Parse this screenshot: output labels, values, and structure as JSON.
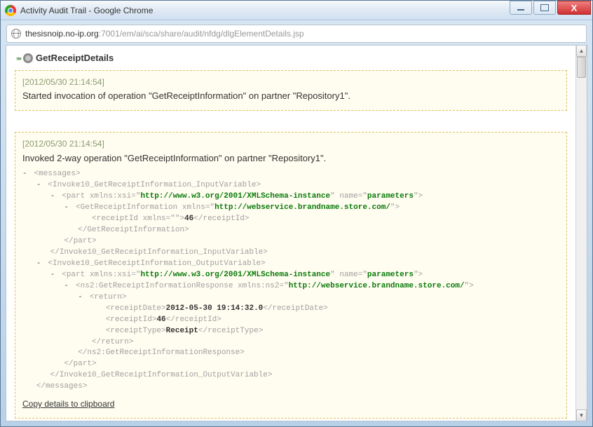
{
  "window": {
    "title": "Activity Audit Trail - Google Chrome"
  },
  "url": {
    "host": "thesisnoip.no-ip.org",
    "path": ":7001/em/ai/sca/share/audit/nfdg/dlgElementDetails.jsp"
  },
  "heading": {
    "text": "GetReceiptDetails"
  },
  "blocks": [
    {
      "timestamp": "[2012/05/30 21:14:54]",
      "message": "Started invocation of operation \"GetReceiptInformation\" on partner \"Repository1\"."
    },
    {
      "timestamp": "[2012/05/30 21:14:54]",
      "message": "Invoked 2-way operation \"GetReceiptInformation\" on partner \"Repository1\".",
      "xml": {
        "root": "messages",
        "input_var": "Invoke10_GetReceiptInformation_InputVariable",
        "output_var": "Invoke10_GetReceiptInformation_OutputVariable",
        "part_attr_xsi": "xmlns:xsi",
        "part_attr_xsi_val": "http://www.w3.org/2001/XMLSchema-instance",
        "part_attr_name": "name",
        "part_attr_name_val": "parameters",
        "gri_tag": "GetReceiptInformation",
        "gri_attr": "xmlns",
        "gri_attr_val": "http://webservice.brandname.store.com/",
        "receiptId_tag": "receiptId",
        "receiptId_attr": "xmlns",
        "receiptId_attr_val": "",
        "receiptId_val": "46",
        "resp_tag": "ns2:GetReceiptInformationResponse",
        "resp_attr": "xmlns:ns2",
        "resp_attr_val": "http://webservice.brandname.store.com/",
        "return_tag": "return",
        "receiptDate_tag": "receiptDate",
        "receiptDate_val": "2012-05-30 19:14:32.0",
        "receiptId2_val": "46",
        "receiptType_tag": "receiptType",
        "receiptType_val": "Receipt"
      },
      "clipboard_link": "Copy details to clipboard"
    }
  ]
}
